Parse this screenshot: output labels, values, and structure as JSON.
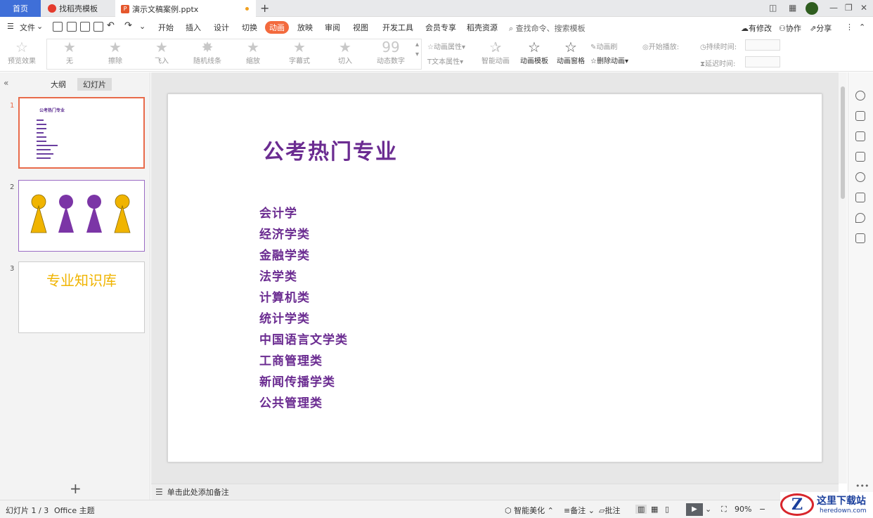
{
  "tabs": {
    "home": "首页",
    "template": "找稻壳模板",
    "document": "演示文稿案例.pptx"
  },
  "menu": {
    "file": "文件",
    "items": [
      "开始",
      "插入",
      "设计",
      "切换",
      "动画",
      "放映",
      "审阅",
      "视图",
      "开发工具",
      "会员专享",
      "稻壳资源"
    ],
    "active": "动画",
    "search": "查找命令、搜索模板",
    "modified": "有修改",
    "collab": "协作",
    "share": "分享"
  },
  "ribbon": {
    "preview": "预览效果",
    "gallery": [
      "无",
      "擦除",
      "飞入",
      "随机线条",
      "缩放",
      "字幕式",
      "切入",
      "动态数字"
    ],
    "anim_props": "动画属性",
    "text_props": "文本属性",
    "smart_anim": "智能动画",
    "anim_template": "动画模板",
    "anim_pane": "动画窗格",
    "anim_brush": "动画刷",
    "delete_anim": "删除动画",
    "start_play": "开始播放:",
    "duration": "持续时间:",
    "delay": "延迟时间:"
  },
  "panel": {
    "outline_tab": "大纲",
    "slides_tab": "幻灯片",
    "thumb1_title": "公考热门专业",
    "thumb3_title": "专业知识库",
    "slide_numbers": [
      "1",
      "2",
      "3"
    ]
  },
  "slide": {
    "title": "公考热门专业",
    "items": [
      "会计学",
      "经济学类",
      "金融学类",
      "法学类",
      "计算机类",
      "统计学类",
      "中国语言文学类",
      "工商管理类",
      "新闻传播学类",
      "公共管理类"
    ]
  },
  "notes": "单击此处添加备注",
  "status": {
    "slide_count": "幻灯片 1 / 3",
    "theme": "Office 主题",
    "beautify": "智能美化",
    "notes_btn": "备注",
    "comment": "批注",
    "zoom": "90%"
  },
  "watermark": {
    "logo": "Z",
    "name": "这里下载站",
    "url": "heredown.com"
  },
  "colors": {
    "accent": "#f36a3d",
    "slide_text": "#6b2c91",
    "thumb_yellow": "#f0b400",
    "thumb_purple": "#7b35a6"
  }
}
